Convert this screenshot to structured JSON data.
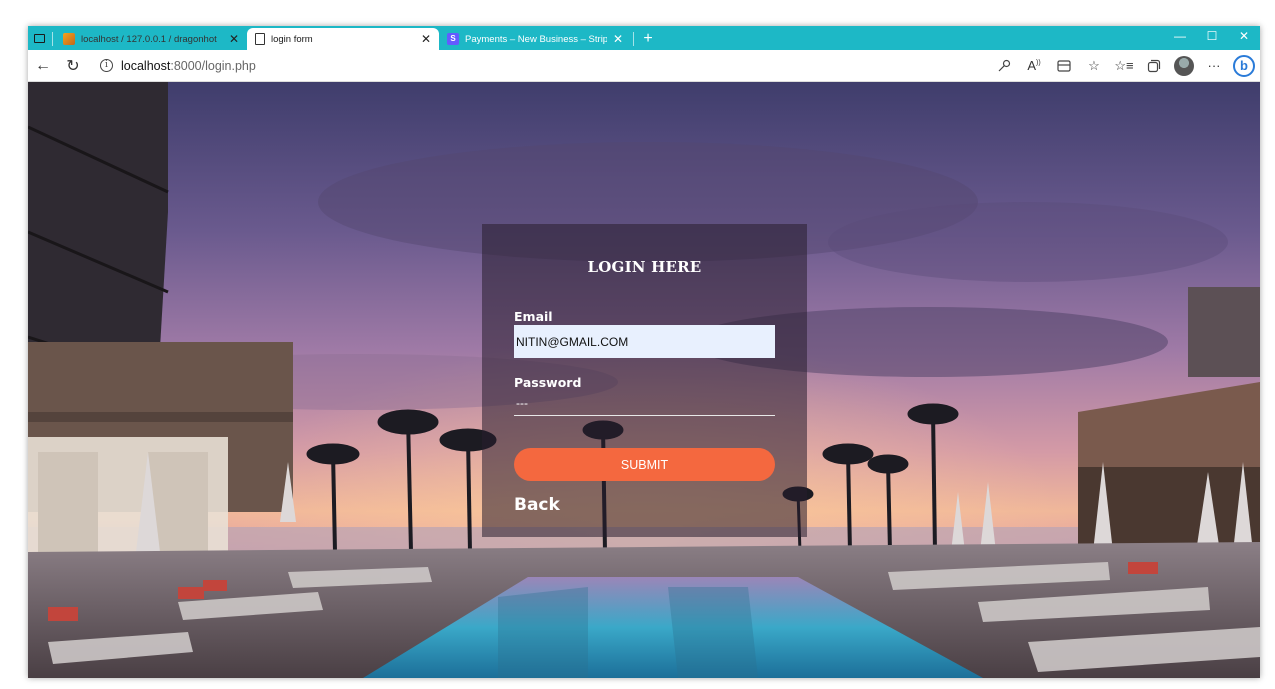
{
  "browser": {
    "tabs": [
      {
        "title": "localhost / 127.0.0.1 / dragonhot",
        "favicon": "phpmyadmin-icon"
      },
      {
        "title": "login form",
        "favicon": "page-icon",
        "active": true
      },
      {
        "title": "Payments – New Business – Stripe",
        "favicon": "stripe-icon"
      }
    ],
    "address": {
      "host": "localhost",
      "path": ":8000/login.php"
    }
  },
  "login": {
    "heading": "LOGIN HERE",
    "email_label": "Email",
    "email_value": "NITIN@GMAIL.COM",
    "password_label": "Password",
    "password_value": "---",
    "submit_label": "SUBMIT",
    "back_label": "Back"
  },
  "colors": {
    "tab_strip": "#1db8c6",
    "submit": "#f4683f",
    "autofill": "#e8f0fe"
  }
}
